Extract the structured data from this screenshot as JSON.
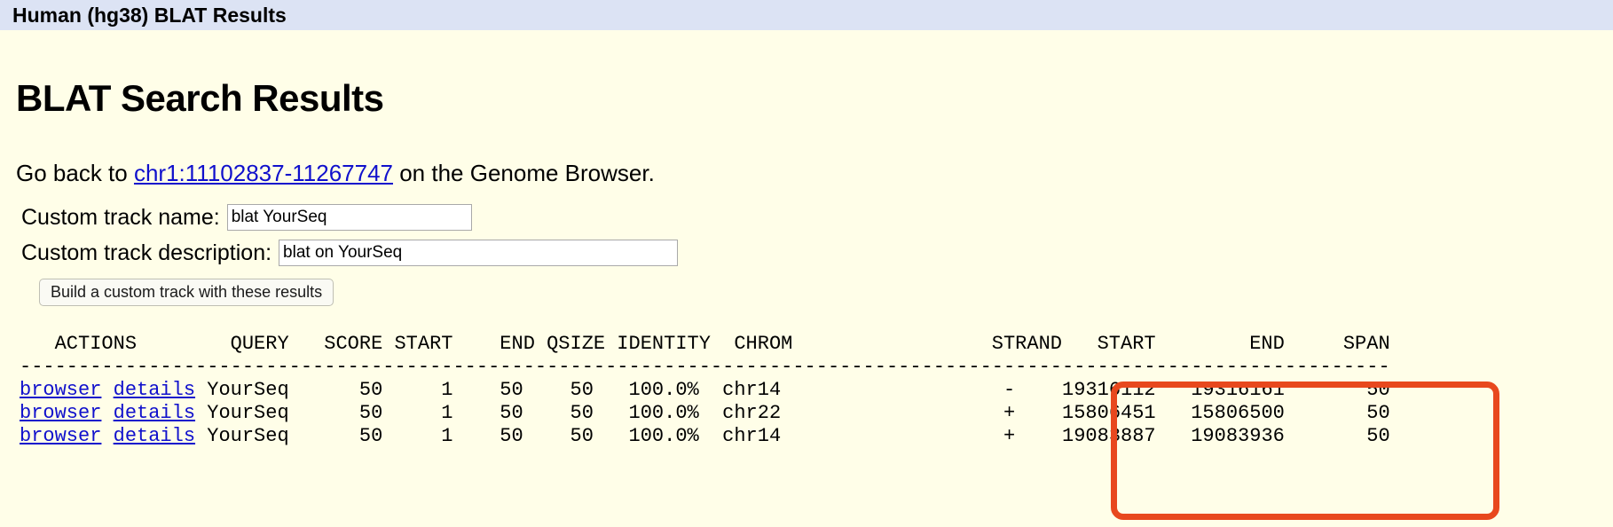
{
  "titlebar": {
    "title": "Human (hg38) BLAT Results"
  },
  "main": {
    "heading": "BLAT Search Results",
    "goback_prefix": "Go back to ",
    "goback_link": "chr1:11102837-11267747",
    "goback_suffix": " on the Genome Browser."
  },
  "form": {
    "track_name_label": "Custom track name:",
    "track_name_value": "blat YourSeq",
    "track_desc_label": "Custom track description:",
    "track_desc_value": "blat on YourSeq",
    "build_button_label": "Build a custom track with these results"
  },
  "results_table": {
    "columns": [
      "ACTIONS",
      "QUERY",
      "SCORE",
      "START",
      "END",
      "QSIZE",
      "IDENTITY",
      "CHROM",
      "STRAND",
      "START",
      "END",
      "SPAN"
    ],
    "header_line": "   ACTIONS        QUERY   SCORE START    END QSIZE IDENTITY  CHROM                 STRAND   START        END     SPAN",
    "separator_line": "---------------------------------------------------------------------------------------------------------------------",
    "action_browser": "browser",
    "action_details": "details",
    "rows": [
      {
        "query": "YourSeq",
        "score": "50",
        "qstart": "1",
        "qend": "50",
        "qsize": "50",
        "identity": "100.0%",
        "chrom": "chr14",
        "strand": "-",
        "tstart": "19316112",
        "tend": "19316161",
        "span": "50",
        "text": " YourSeq      50     1    50    50   100.0%  chr14                   -    19316112   19316161       50"
      },
      {
        "query": "YourSeq",
        "score": "50",
        "qstart": "1",
        "qend": "50",
        "qsize": "50",
        "identity": "100.0%",
        "chrom": "chr22",
        "strand": "+",
        "tstart": "15806451",
        "tend": "15806500",
        "span": "50",
        "text": " YourSeq      50     1    50    50   100.0%  chr22                   +    15806451   15806500       50"
      },
      {
        "query": "YourSeq",
        "score": "50",
        "qstart": "1",
        "qend": "50",
        "qsize": "50",
        "identity": "100.0%",
        "chrom": "chr14",
        "strand": "+",
        "tstart": "19083887",
        "tend": "19083936",
        "span": "50",
        "text": " YourSeq      50     1    50    50   100.0%  chr14                   +    19083887   19083936       50"
      }
    ]
  },
  "annotation": {
    "highlight_color": "#E8481E",
    "highlighted_columns": "STRAND START END"
  },
  "colors": {
    "titlebar_bg": "#DCE3F4",
    "page_bg": "#FFFEE8",
    "link": "#1010CC",
    "highlight": "#E8481E"
  }
}
